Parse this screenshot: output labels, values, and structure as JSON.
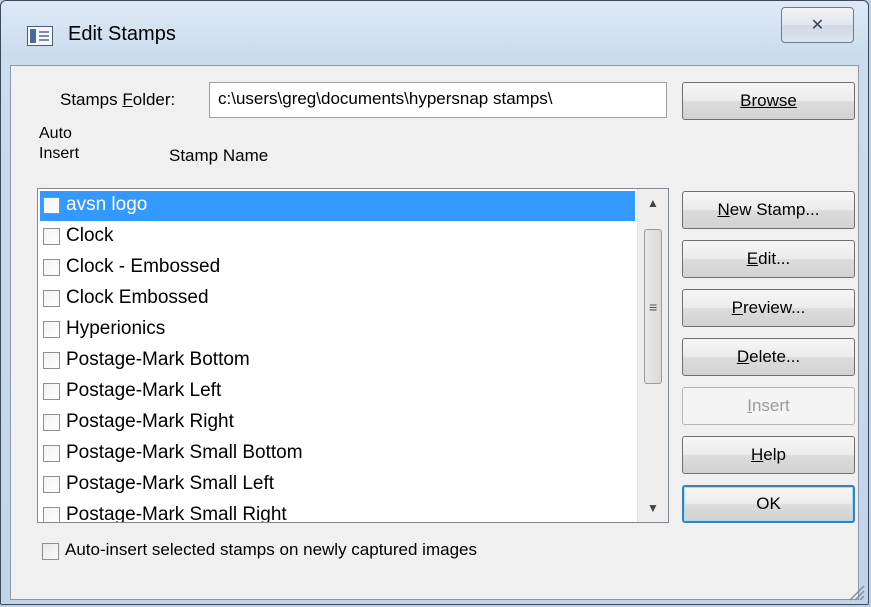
{
  "window": {
    "title": "Edit Stamps",
    "close_glyph": "✕"
  },
  "folder": {
    "label_pre": "Stamps ",
    "label_accel": "F",
    "label_post": "older:",
    "value": "c:\\users\\greg\\documents\\hypersnap stamps\\"
  },
  "browse": {
    "label": "Browse"
  },
  "columns": {
    "auto_insert_line1": "Auto",
    "auto_insert_line2": "Insert",
    "stamp_name": "Stamp Name"
  },
  "stamps": [
    {
      "name": "avsn logo",
      "checked": false,
      "selected": true
    },
    {
      "name": "Clock",
      "checked": false
    },
    {
      "name": "Clock - Embossed",
      "checked": false
    },
    {
      "name": "Clock Embossed",
      "checked": false
    },
    {
      "name": "Hyperionics",
      "checked": false
    },
    {
      "name": "Postage-Mark Bottom",
      "checked": false
    },
    {
      "name": "Postage-Mark Left",
      "checked": false
    },
    {
      "name": "Postage-Mark Right",
      "checked": false
    },
    {
      "name": "Postage-Mark Small Bottom",
      "checked": false
    },
    {
      "name": "Postage-Mark Small Left",
      "checked": false
    },
    {
      "name": "Postage-Mark Small Right",
      "checked": false
    }
  ],
  "buttons": {
    "new_stamp": {
      "accel": "N",
      "rest": "ew Stamp..."
    },
    "edit": {
      "accel": "E",
      "rest": "dit..."
    },
    "preview": {
      "accel": "P",
      "rest": "review..."
    },
    "delete": {
      "accel": "D",
      "rest": "elete..."
    },
    "insert": {
      "accel": "I",
      "rest": "nsert",
      "disabled": true
    },
    "help": {
      "accel": "H",
      "rest": "elp"
    },
    "ok": {
      "label": "OK"
    }
  },
  "auto_insert_option": {
    "label": "Auto-insert selected stamps on newly captured images",
    "checked": false
  },
  "icons": {
    "scroll_up": "up-arrow-icon",
    "scroll_down": "down-arrow-icon",
    "grip": "scroll-grip-icon",
    "close": "close-icon",
    "app": "stamp-dialog-icon"
  },
  "colors": {
    "selection": "#3399ff",
    "default_button_border": "#3c7fb1"
  }
}
